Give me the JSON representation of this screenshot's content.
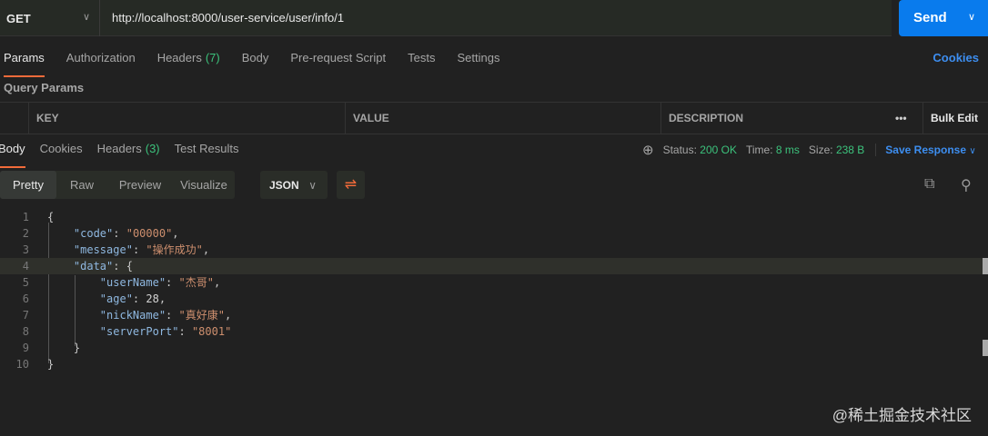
{
  "request": {
    "method": "GET",
    "url": "http://localhost:8000/user-service/user/info/1",
    "send": "Send"
  },
  "request_tabs": [
    {
      "label": "Params",
      "count": null
    },
    {
      "label": "Authorization",
      "count": null
    },
    {
      "label": "Headers",
      "count": "(7)"
    },
    {
      "label": "Body",
      "count": null
    },
    {
      "label": "Pre-request Script",
      "count": null
    },
    {
      "label": "Tests",
      "count": null
    },
    {
      "label": "Settings",
      "count": null
    }
  ],
  "cookies": "Cookies",
  "query_params": "Query Params",
  "table": {
    "key": "KEY",
    "value": "VALUE",
    "description": "DESCRIPTION",
    "more": "•••",
    "bulk_edit": "Bulk Edit"
  },
  "response_tabs": [
    {
      "label": "Body",
      "count": null
    },
    {
      "label": "Cookies",
      "count": null
    },
    {
      "label": "Headers",
      "count": "(3)"
    },
    {
      "label": "Test Results",
      "count": null
    }
  ],
  "status": {
    "status_label": "Status:",
    "status": "200 OK",
    "time_label": "Time:",
    "time": "8 ms",
    "size_label": "Size:",
    "size": "238 B",
    "save": "Save Response"
  },
  "view_modes": [
    "Pretty",
    "Raw",
    "Preview",
    "Visualize"
  ],
  "format": "JSON",
  "code_lines": [
    [
      [
        "p",
        "{"
      ]
    ],
    [
      [
        "p",
        "    "
      ],
      [
        "k",
        "\"code\""
      ],
      [
        "p",
        ": "
      ],
      [
        "s",
        "\"00000\""
      ],
      [
        "p",
        ","
      ]
    ],
    [
      [
        "p",
        "    "
      ],
      [
        "k",
        "\"message\""
      ],
      [
        "p",
        ": "
      ],
      [
        "s",
        "\"操作成功\""
      ],
      [
        "p",
        ","
      ]
    ],
    [
      [
        "p",
        "    "
      ],
      [
        "k",
        "\"data\""
      ],
      [
        "p",
        ": {"
      ]
    ],
    [
      [
        "p",
        "        "
      ],
      [
        "k",
        "\"userName\""
      ],
      [
        "p",
        ": "
      ],
      [
        "s",
        "\"杰哥\""
      ],
      [
        "p",
        ","
      ]
    ],
    [
      [
        "p",
        "        "
      ],
      [
        "k",
        "\"age\""
      ],
      [
        "p",
        ": "
      ],
      [
        "n",
        "28"
      ],
      [
        "p",
        ","
      ]
    ],
    [
      [
        "p",
        "        "
      ],
      [
        "k",
        "\"nickName\""
      ],
      [
        "p",
        ": "
      ],
      [
        "s",
        "\"真好康\""
      ],
      [
        "p",
        ","
      ]
    ],
    [
      [
        "p",
        "        "
      ],
      [
        "k",
        "\"serverPort\""
      ],
      [
        "p",
        ": "
      ],
      [
        "s",
        "\"8001\""
      ]
    ],
    [
      [
        "p",
        "    }"
      ]
    ],
    [
      [
        "p",
        "}"
      ]
    ]
  ],
  "watermark": "@稀土掘金技术社区"
}
